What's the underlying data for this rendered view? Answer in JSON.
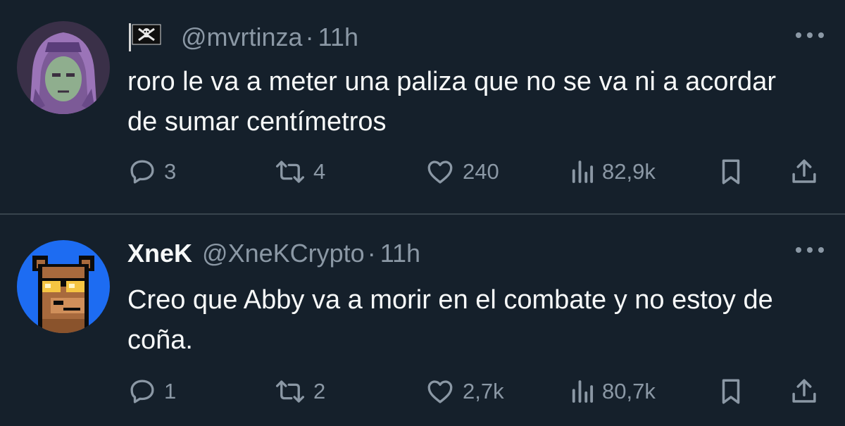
{
  "tweets": [
    {
      "display_name": "",
      "handle": "@mvrtinza",
      "separator": "·",
      "time": "11h",
      "text": "roro le va a meter una paliza que no se va ni a acordar de sumar centímetros",
      "stats": {
        "replies": "3",
        "retweets": "4",
        "likes": "240",
        "views": "82,9k"
      },
      "icons": [
        "pirate-flag-icon",
        "more-icon",
        "reply-icon",
        "retweet-icon",
        "like-icon",
        "views-icon",
        "bookmark-icon",
        "share-icon"
      ]
    },
    {
      "display_name": "XneK",
      "handle": "@XneKCrypto",
      "separator": "·",
      "time": "11h",
      "text": "Creo que Abby va a morir en el combate y no estoy de coña.",
      "stats": {
        "replies": "1",
        "retweets": "2",
        "likes": "2,7k",
        "views": "80,7k"
      },
      "icons": [
        "more-icon",
        "reply-icon",
        "retweet-icon",
        "like-icon",
        "views-icon",
        "bookmark-icon",
        "share-icon"
      ]
    }
  ],
  "colors": {
    "background": "#15202b",
    "text_primary": "#f7f9f9",
    "text_secondary": "#8b98a5",
    "divider": "#38444d",
    "avatar2_bg": "#1d6cf2"
  }
}
